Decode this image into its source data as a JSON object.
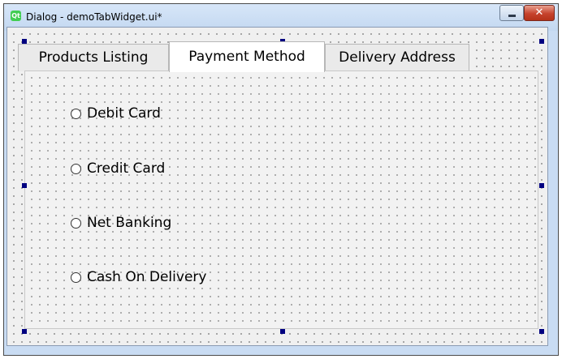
{
  "window": {
    "title": "Dialog - demoTabWidget.ui*",
    "app_icon": "qt-logo-icon",
    "minimize_icon": "minimize-icon",
    "close_icon": "close-icon",
    "close_glyph": "✕"
  },
  "tabs": [
    {
      "label": "Products Listing",
      "active": false
    },
    {
      "label": "Payment Method",
      "active": true
    },
    {
      "label": "Delivery Address",
      "active": false
    }
  ],
  "payment_options": [
    {
      "label": "Debit Card",
      "checked": false
    },
    {
      "label": "Credit Card",
      "checked": false
    },
    {
      "label": "Net Banking",
      "checked": false
    },
    {
      "label": "Cash On Delivery",
      "checked": false
    }
  ],
  "colors": {
    "selection_handle": "#000080",
    "close_button": "#c6422c",
    "qt_logo": "#41cd52"
  }
}
